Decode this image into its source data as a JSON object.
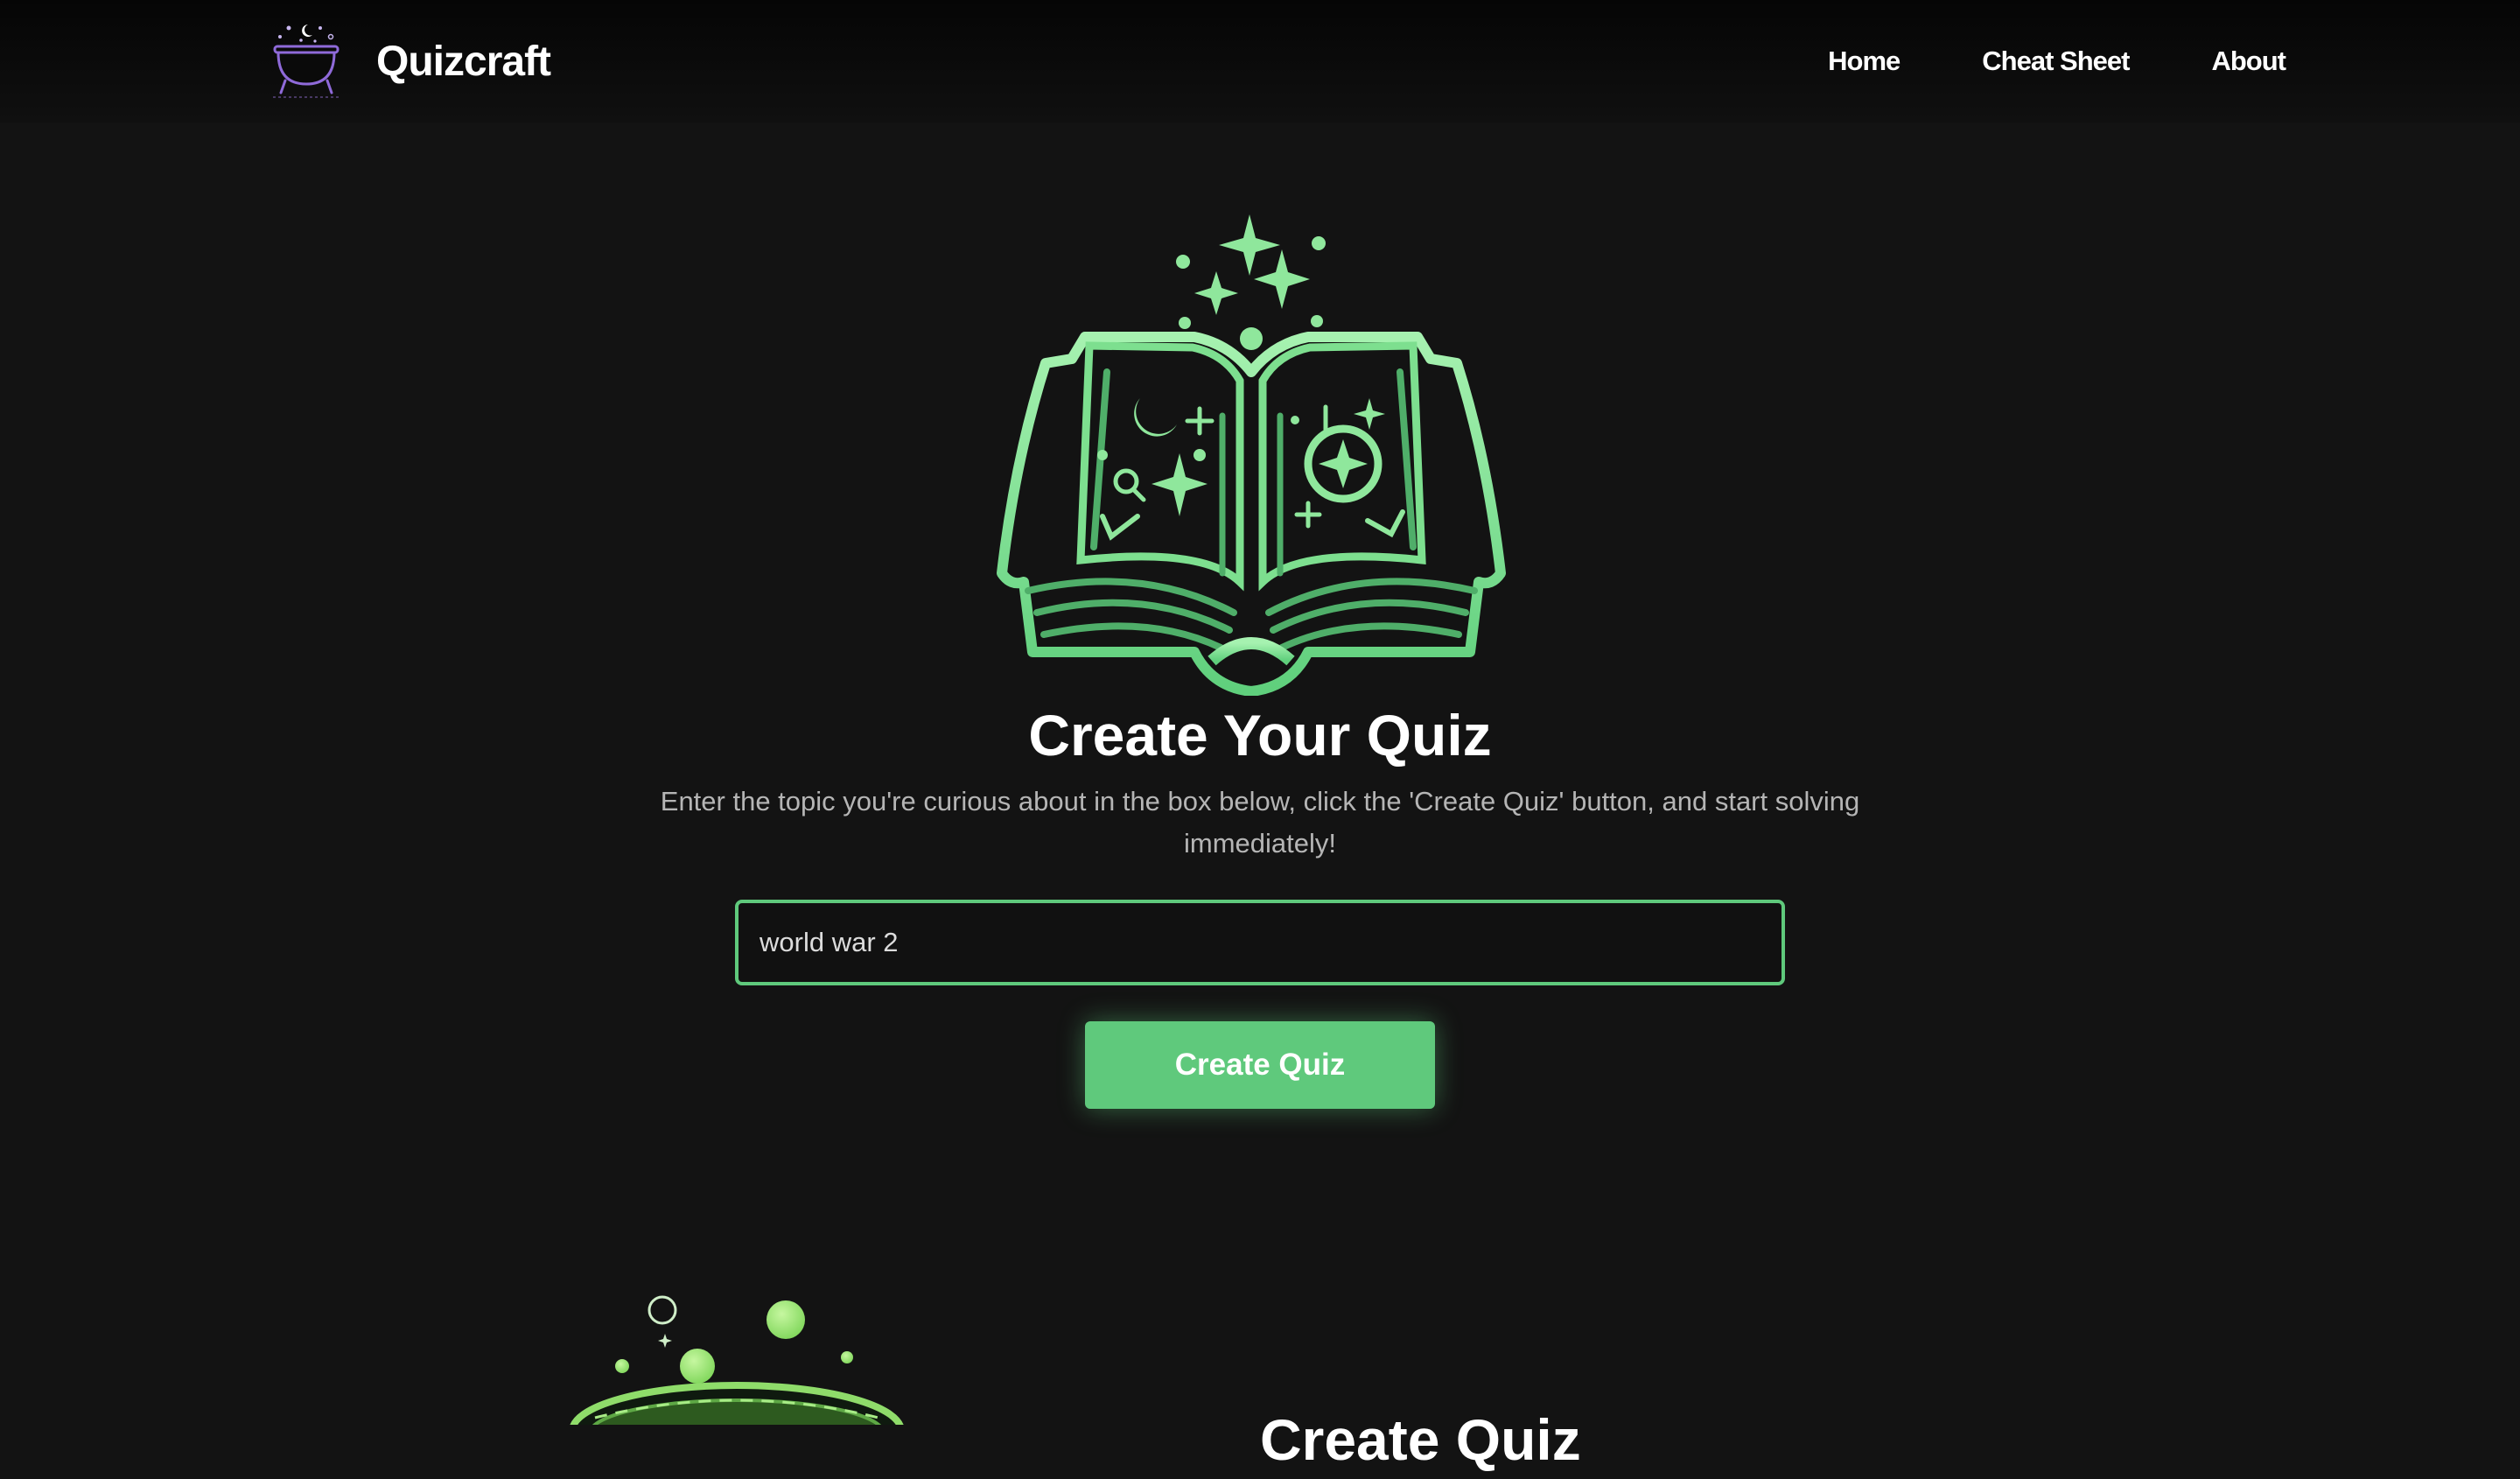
{
  "app": {
    "name": "Quizcraft",
    "logo_icon": "cauldron-icon"
  },
  "nav": {
    "items": [
      {
        "label": "Home"
      },
      {
        "label": "Cheat Sheet"
      },
      {
        "label": "About"
      }
    ]
  },
  "hero": {
    "icon": "magic-book-icon",
    "title": "Create Your Quiz",
    "subtitle": "Enter the topic you're curious about in the box below, click the 'Create Quiz' button, and start solving immediately!",
    "input": {
      "value": "world war 2",
      "placeholder": ""
    },
    "button_label": "Create Quiz"
  },
  "next_section": {
    "icon": "bubbling-cauldron-icon",
    "title_partial": "Create Quiz"
  },
  "colors": {
    "background": "#131313",
    "accent_green": "#5fc97c",
    "light_green": "#a6f2b0",
    "logo_purple": "#8f6ad9"
  }
}
